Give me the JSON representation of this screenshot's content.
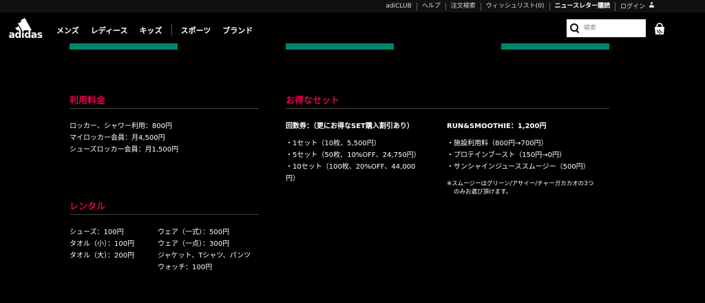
{
  "utility": {
    "links": [
      "adiCLUB",
      "ヘルプ",
      "注文検索",
      "ウィッシュリスト(0)",
      "ニュースレター購読"
    ],
    "login": "ログイン"
  },
  "brand": {
    "logo_text": "adidas"
  },
  "nav": {
    "items": [
      "メンズ",
      "レディース",
      "キッズ",
      "スポーツ",
      "ブランド"
    ]
  },
  "search": {
    "placeholder": "検索"
  },
  "colors": {
    "accent": "#e3004f",
    "green": "#00856f"
  },
  "pricing": {
    "title": "利用料金",
    "lines": [
      "ロッカー、シャワー利用：800円",
      "マイロッカー会員：月4,500円",
      "シューズロッカー会員：月1,500円"
    ]
  },
  "rental": {
    "title": "レンタル",
    "left": [
      "シューズ：100円",
      "タオル（小）：100円",
      "タオル（大）：200円"
    ],
    "right": [
      "ウェア（一式）：500円",
      "ウェア（一点）：300円",
      "ジャケット、Tシャツ、パンツ",
      "ウォッチ：100円"
    ]
  },
  "sets": {
    "title": "お得なセット",
    "tickets": {
      "heading": "回数券：（更にお得なSET購入割引あり）",
      "lines": [
        "・1セット（10枚、5,500円）",
        "・5セット（50枚、10%OFF、24,750円）",
        "・10セット（100枚、20%OFF、44,000",
        "円）"
      ]
    },
    "smoothie": {
      "heading": "RUN&SMOOTHIE：1,200円",
      "lines": [
        "・施設利用料（800円→700円）",
        "・プロテインブースト（150円→0円）",
        "・サンシャインジューススムージー（500円）"
      ],
      "note": [
        "※スムージーはグリーン/アサイー/チャーガカカオの3つ",
        "のみお選び頂けます。"
      ]
    }
  }
}
